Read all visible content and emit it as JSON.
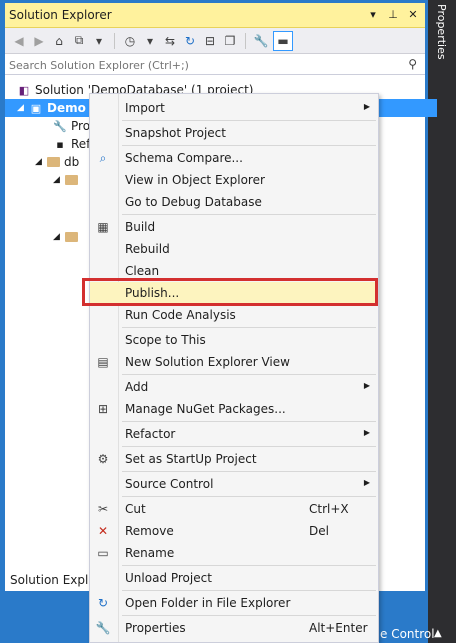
{
  "panel": {
    "title": "Solution Explorer",
    "ctrl_dropdown": "▾",
    "ctrl_pin": "⊥",
    "ctrl_close": "✕",
    "search_placeholder": "Search Solution Explorer (Ctrl+;)",
    "status_text": "Solution Explor"
  },
  "side_tab": {
    "label": "Properties"
  },
  "bottom_bar": {
    "label": "e Control"
  },
  "tree": {
    "solution_label": "Solution 'DemoDatabase' (1 project)",
    "project_label": "Demo",
    "child1": "Pro",
    "child2": "Ref",
    "child3": "db"
  },
  "menu": {
    "items": [
      {
        "label": "Import",
        "shortcut": "",
        "submenu": true
      },
      {
        "label": "Snapshot Project",
        "shortcut": "",
        "submenu": false
      },
      {
        "label": "Schema Compare...",
        "shortcut": "",
        "submenu": false
      },
      {
        "label": "View in Object Explorer",
        "shortcut": "",
        "submenu": false
      },
      {
        "label": "Go to Debug Database",
        "shortcut": "",
        "submenu": false
      },
      {
        "label": "Build",
        "shortcut": "",
        "submenu": false
      },
      {
        "label": "Rebuild",
        "shortcut": "",
        "submenu": false
      },
      {
        "label": "Clean",
        "shortcut": "",
        "submenu": false
      },
      {
        "label": "Publish...",
        "shortcut": "",
        "submenu": false
      },
      {
        "label": "Run Code Analysis",
        "shortcut": "",
        "submenu": false
      },
      {
        "label": "Scope to This",
        "shortcut": "",
        "submenu": false
      },
      {
        "label": "New Solution Explorer View",
        "shortcut": "",
        "submenu": false
      },
      {
        "label": "Add",
        "shortcut": "",
        "submenu": true
      },
      {
        "label": "Manage NuGet Packages...",
        "shortcut": "",
        "submenu": false
      },
      {
        "label": "Refactor",
        "shortcut": "",
        "submenu": true
      },
      {
        "label": "Set as StartUp Project",
        "shortcut": "",
        "submenu": false
      },
      {
        "label": "Source Control",
        "shortcut": "",
        "submenu": true
      },
      {
        "label": "Cut",
        "shortcut": "Ctrl+X",
        "submenu": false
      },
      {
        "label": "Remove",
        "shortcut": "Del",
        "submenu": false
      },
      {
        "label": "Rename",
        "shortcut": "",
        "submenu": false
      },
      {
        "label": "Unload Project",
        "shortcut": "",
        "submenu": false
      },
      {
        "label": "Open Folder in File Explorer",
        "shortcut": "",
        "submenu": false
      },
      {
        "label": "Properties",
        "shortcut": "Alt+Enter",
        "submenu": false
      }
    ],
    "submenu_glyph": "▶"
  },
  "colors": {
    "title_bar": "#fff29d",
    "selection": "#3399ff",
    "menu_highlight": "#fdf4bf",
    "callout_border": "#d32f2f",
    "frame": "#2a7ac9"
  }
}
